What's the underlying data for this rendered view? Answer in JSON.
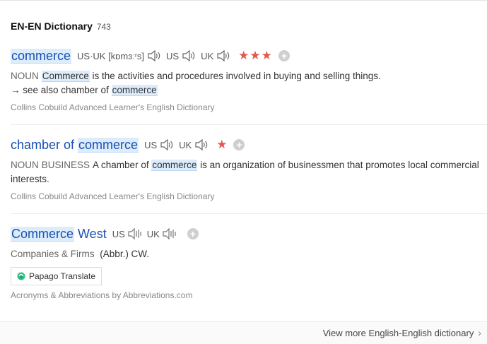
{
  "header": {
    "title": "EN-EN Dictionary",
    "count": "743"
  },
  "entries": [
    {
      "word_parts": [
        "commerce"
      ],
      "pron_label": "US·UK [kɒmɜːʳs]",
      "us_label": "US",
      "uk_label": "UK",
      "stars": "★★★",
      "pos": "NOUN",
      "def_word": "Commerce",
      "def_rest": " is the activities and procedures involved in buying and selling things.",
      "see_also_prefix": "→ see also chamber of ",
      "see_also_word": "commerce",
      "source": "Collins Cobuild Advanced Learner's English Dictionary"
    },
    {
      "word_prefix": "chamber of ",
      "word_hl": "commerce",
      "us_label": "US",
      "uk_label": "UK",
      "stars": "★",
      "pos": "NOUN",
      "tag": "BUSINESS",
      "def_pre": "A chamber of ",
      "def_word": "commerce",
      "def_rest": " is an organization of businessmen that promotes local commercial interests.",
      "source": "Collins Cobuild Advanced Learner's English Dictionary"
    },
    {
      "word_hl": "Commerce",
      "word_suffix": " West",
      "us_label": "US",
      "uk_label": "UK",
      "category": "Companies & Firms",
      "def": "(Abbr.) CW.",
      "translate_button": "Papago Translate",
      "source": "Acronyms & Abbreviations by Abbreviations.com"
    }
  ],
  "footer": {
    "more_link": "View more English-English dictionary"
  }
}
